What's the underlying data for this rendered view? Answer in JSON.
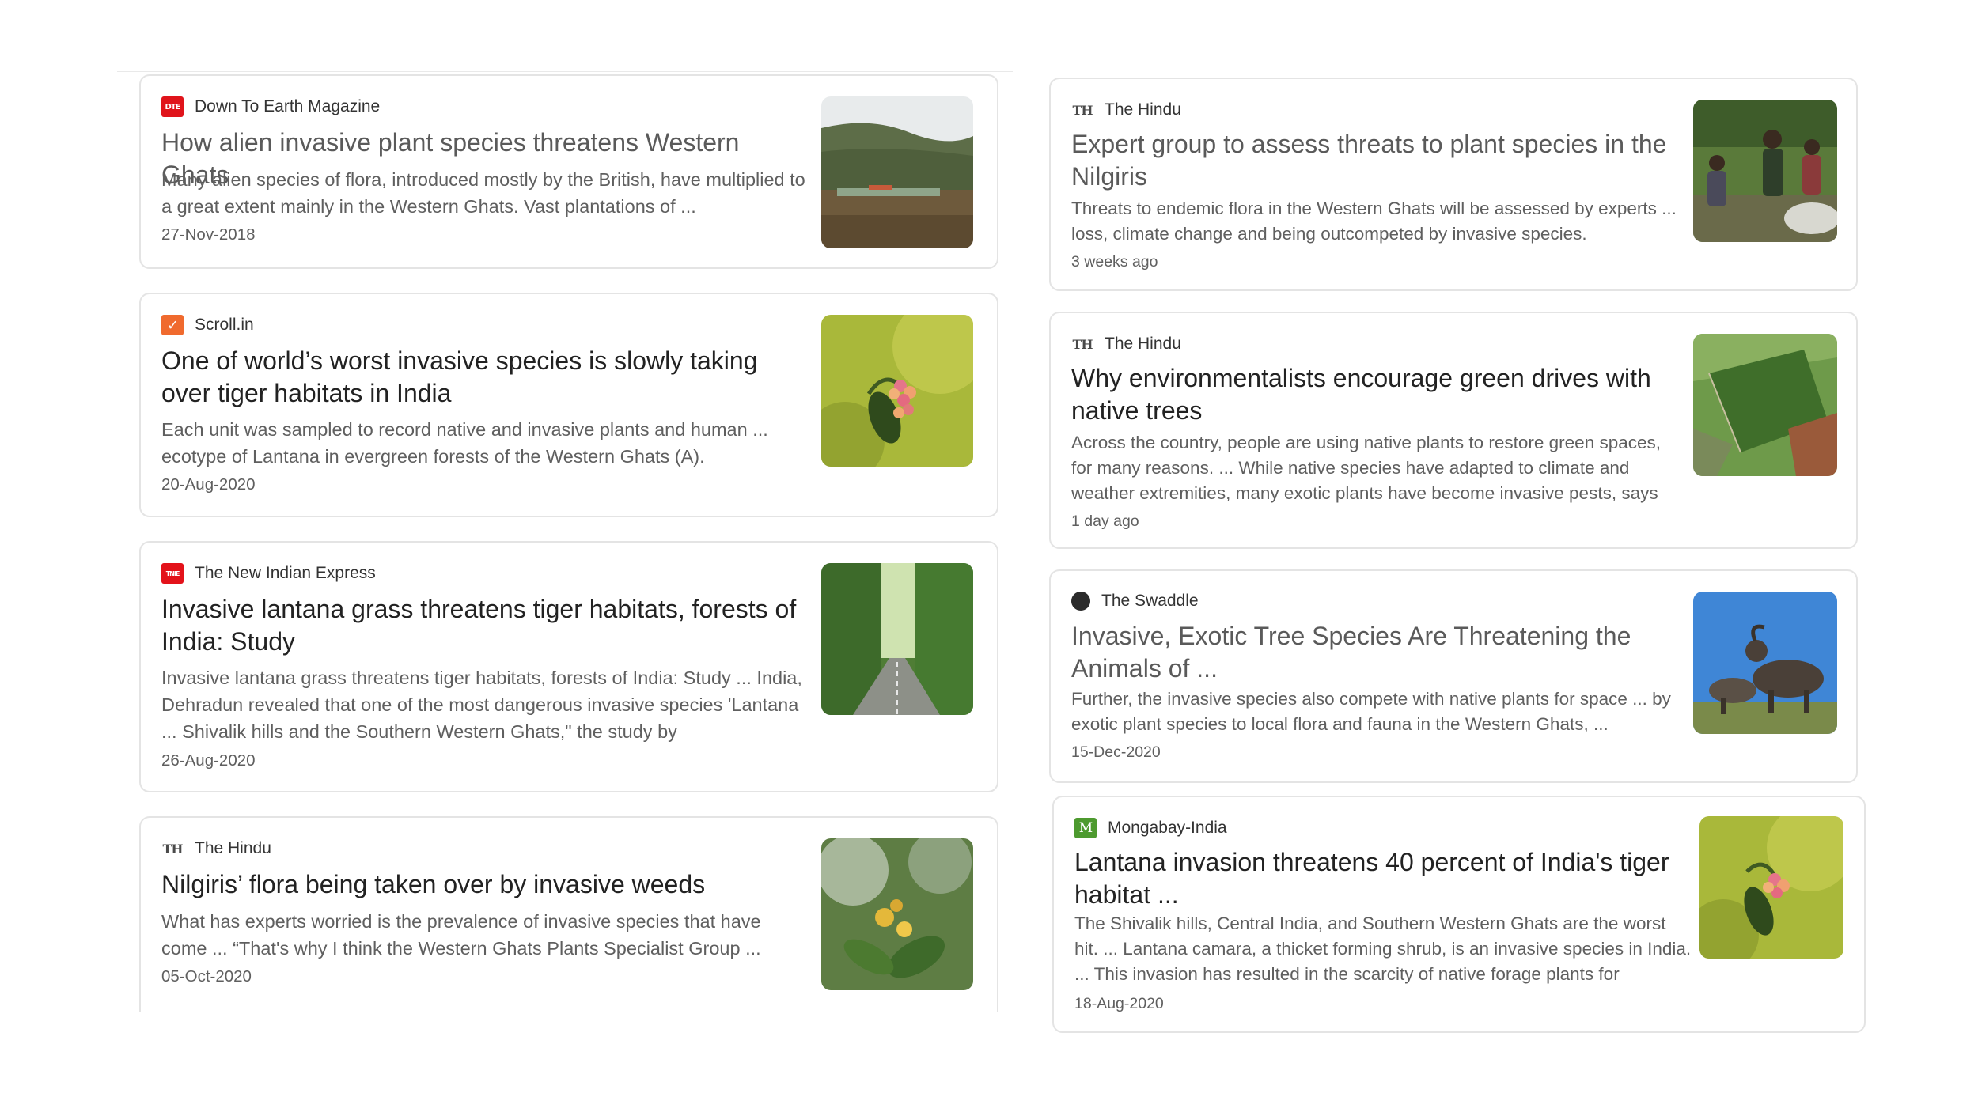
{
  "left_column": [
    {
      "source": "Down To Earth Magazine",
      "logo_icon": "dte-logo-icon",
      "logo_text": "DTE",
      "title": "How alien invasive plant species threatens Western Ghats",
      "snippet": "Many alien species of flora, introduced mostly by the British, have multiplied to a great extent mainly in the Western Ghats. Vast plantations of ...",
      "date": "27-Nov-2018",
      "thumbnail": "hillside-plantation-photo"
    },
    {
      "source": "Scroll.in",
      "logo_icon": "scroll-logo-icon",
      "logo_text": "✓",
      "title": "One of world’s worst invasive species is slowly taking over tiger habitats in India",
      "snippet": "Each unit was sampled to record native and invasive plants and human ... ecotype of Lantana in evergreen forests of the Western Ghats (A).",
      "date": "20-Aug-2020",
      "thumbnail": "lantana-flower-photo"
    },
    {
      "source": "The New Indian Express",
      "logo_icon": "tnie-logo-icon",
      "logo_text": "TNIE",
      "title": "Invasive lantana grass threatens tiger habitats, forests of India: Study",
      "snippet": "Invasive lantana grass threatens tiger habitats, forests of India: Study ... India, Dehradun revealed that one of the most dangerous invasive species 'Lantana ... Shivalik hills and the Southern Western Ghats,\" the study by",
      "date": "26-Aug-2020",
      "thumbnail": "forest-road-photo"
    },
    {
      "source": "The Hindu",
      "logo_icon": "the-hindu-logo-icon",
      "logo_text": "TH",
      "title": "Nilgiris’ flora being taken over by invasive weeds",
      "snippet": "What has experts worried is the prevalence of invasive species that have come ... “That's why I think the Western Ghats Plants Specialist Group ...",
      "date": "05-Oct-2020",
      "thumbnail": "yellow-flowers-photo"
    }
  ],
  "right_column": [
    {
      "source": "The Hindu",
      "logo_icon": "the-hindu-logo-icon",
      "logo_text": "TH",
      "title": "Expert group to assess threats to plant species in the Nilgiris",
      "snippet": "Threats to endemic flora in the Western Ghats will be assessed by experts ... loss, climate change and being outcompeted by invasive species.",
      "date": "3 weeks ago",
      "thumbnail": "people-outdoors-photo"
    },
    {
      "source": "The Hindu",
      "logo_icon": "the-hindu-logo-icon",
      "logo_text": "TH",
      "title": "Why environmentalists encourage green drives with native trees",
      "snippet": "Across the country, people are using native plants to restore green spaces, for many reasons. ... While native species have adapted to climate and weather extremities, many exotic plants have become invasive pests, says",
      "date": "1 day ago",
      "thumbnail": "aerial-farmland-photo"
    },
    {
      "source": "The Swaddle",
      "logo_icon": "swaddle-logo-icon",
      "logo_text": "",
      "title": "Invasive, Exotic Tree Species Are Threatening the Animals of ...",
      "snippet": "Further, the invasive species also compete with native plants for space ... by exotic plant species to local flora and fauna in the Western Ghats, ...",
      "date": "15-Dec-2020",
      "thumbnail": "nilgiri-tahr-photo"
    },
    {
      "source": "Mongabay-India",
      "logo_icon": "mongabay-logo-icon",
      "logo_text": "M",
      "title": "Lantana invasion threatens 40 percent of India's tiger habitat ...",
      "snippet": "The Shivalik hills, Central India, and Southern Western Ghats are the worst hit. ... Lantana camara, a thicket forming shrub, is an invasive species in India. ... This invasion has resulted in the scarcity of native forage plants for",
      "date": "18-Aug-2020",
      "thumbnail": "lantana-flower-photo"
    }
  ],
  "colors": {
    "card_border": "#e4e4e4",
    "title_text": "#222222",
    "snippet_text": "#5f5f5f"
  }
}
